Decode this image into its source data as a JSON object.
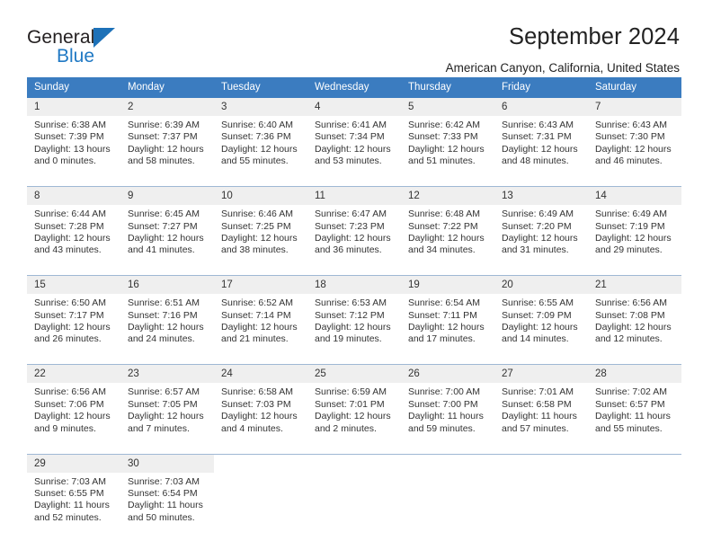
{
  "brand": {
    "name_top": "General",
    "name_bottom": "Blue",
    "triangle_color": "#1d71b8",
    "text_color": "#231f20",
    "blue_text_color": "#2079c4"
  },
  "header": {
    "title": "September 2024",
    "subtitle": "American Canyon, California, United States"
  },
  "theme": {
    "header_bg": "#3b7cc0",
    "header_text": "#ffffff",
    "daynum_bg": "#efefef",
    "border": "#9fb8d4",
    "body_text": "#333333"
  },
  "weekdays": [
    "Sunday",
    "Monday",
    "Tuesday",
    "Wednesday",
    "Thursday",
    "Friday",
    "Saturday"
  ],
  "labels": {
    "sunrise_prefix": "Sunrise:",
    "sunset_prefix": "Sunset:",
    "daylight_prefix": "Daylight:"
  },
  "weeks": [
    [
      {
        "day": "1",
        "sunrise": "Sunrise: 6:38 AM",
        "sunset": "Sunset: 7:39 PM",
        "daylight1": "Daylight: 13 hours",
        "daylight2": "and 0 minutes."
      },
      {
        "day": "2",
        "sunrise": "Sunrise: 6:39 AM",
        "sunset": "Sunset: 7:37 PM",
        "daylight1": "Daylight: 12 hours",
        "daylight2": "and 58 minutes."
      },
      {
        "day": "3",
        "sunrise": "Sunrise: 6:40 AM",
        "sunset": "Sunset: 7:36 PM",
        "daylight1": "Daylight: 12 hours",
        "daylight2": "and 55 minutes."
      },
      {
        "day": "4",
        "sunrise": "Sunrise: 6:41 AM",
        "sunset": "Sunset: 7:34 PM",
        "daylight1": "Daylight: 12 hours",
        "daylight2": "and 53 minutes."
      },
      {
        "day": "5",
        "sunrise": "Sunrise: 6:42 AM",
        "sunset": "Sunset: 7:33 PM",
        "daylight1": "Daylight: 12 hours",
        "daylight2": "and 51 minutes."
      },
      {
        "day": "6",
        "sunrise": "Sunrise: 6:43 AM",
        "sunset": "Sunset: 7:31 PM",
        "daylight1": "Daylight: 12 hours",
        "daylight2": "and 48 minutes."
      },
      {
        "day": "7",
        "sunrise": "Sunrise: 6:43 AM",
        "sunset": "Sunset: 7:30 PM",
        "daylight1": "Daylight: 12 hours",
        "daylight2": "and 46 minutes."
      }
    ],
    [
      {
        "day": "8",
        "sunrise": "Sunrise: 6:44 AM",
        "sunset": "Sunset: 7:28 PM",
        "daylight1": "Daylight: 12 hours",
        "daylight2": "and 43 minutes."
      },
      {
        "day": "9",
        "sunrise": "Sunrise: 6:45 AM",
        "sunset": "Sunset: 7:27 PM",
        "daylight1": "Daylight: 12 hours",
        "daylight2": "and 41 minutes."
      },
      {
        "day": "10",
        "sunrise": "Sunrise: 6:46 AM",
        "sunset": "Sunset: 7:25 PM",
        "daylight1": "Daylight: 12 hours",
        "daylight2": "and 38 minutes."
      },
      {
        "day": "11",
        "sunrise": "Sunrise: 6:47 AM",
        "sunset": "Sunset: 7:23 PM",
        "daylight1": "Daylight: 12 hours",
        "daylight2": "and 36 minutes."
      },
      {
        "day": "12",
        "sunrise": "Sunrise: 6:48 AM",
        "sunset": "Sunset: 7:22 PM",
        "daylight1": "Daylight: 12 hours",
        "daylight2": "and 34 minutes."
      },
      {
        "day": "13",
        "sunrise": "Sunrise: 6:49 AM",
        "sunset": "Sunset: 7:20 PM",
        "daylight1": "Daylight: 12 hours",
        "daylight2": "and 31 minutes."
      },
      {
        "day": "14",
        "sunrise": "Sunrise: 6:49 AM",
        "sunset": "Sunset: 7:19 PM",
        "daylight1": "Daylight: 12 hours",
        "daylight2": "and 29 minutes."
      }
    ],
    [
      {
        "day": "15",
        "sunrise": "Sunrise: 6:50 AM",
        "sunset": "Sunset: 7:17 PM",
        "daylight1": "Daylight: 12 hours",
        "daylight2": "and 26 minutes."
      },
      {
        "day": "16",
        "sunrise": "Sunrise: 6:51 AM",
        "sunset": "Sunset: 7:16 PM",
        "daylight1": "Daylight: 12 hours",
        "daylight2": "and 24 minutes."
      },
      {
        "day": "17",
        "sunrise": "Sunrise: 6:52 AM",
        "sunset": "Sunset: 7:14 PM",
        "daylight1": "Daylight: 12 hours",
        "daylight2": "and 21 minutes."
      },
      {
        "day": "18",
        "sunrise": "Sunrise: 6:53 AM",
        "sunset": "Sunset: 7:12 PM",
        "daylight1": "Daylight: 12 hours",
        "daylight2": "and 19 minutes."
      },
      {
        "day": "19",
        "sunrise": "Sunrise: 6:54 AM",
        "sunset": "Sunset: 7:11 PM",
        "daylight1": "Daylight: 12 hours",
        "daylight2": "and 17 minutes."
      },
      {
        "day": "20",
        "sunrise": "Sunrise: 6:55 AM",
        "sunset": "Sunset: 7:09 PM",
        "daylight1": "Daylight: 12 hours",
        "daylight2": "and 14 minutes."
      },
      {
        "day": "21",
        "sunrise": "Sunrise: 6:56 AM",
        "sunset": "Sunset: 7:08 PM",
        "daylight1": "Daylight: 12 hours",
        "daylight2": "and 12 minutes."
      }
    ],
    [
      {
        "day": "22",
        "sunrise": "Sunrise: 6:56 AM",
        "sunset": "Sunset: 7:06 PM",
        "daylight1": "Daylight: 12 hours",
        "daylight2": "and 9 minutes."
      },
      {
        "day": "23",
        "sunrise": "Sunrise: 6:57 AM",
        "sunset": "Sunset: 7:05 PM",
        "daylight1": "Daylight: 12 hours",
        "daylight2": "and 7 minutes."
      },
      {
        "day": "24",
        "sunrise": "Sunrise: 6:58 AM",
        "sunset": "Sunset: 7:03 PM",
        "daylight1": "Daylight: 12 hours",
        "daylight2": "and 4 minutes."
      },
      {
        "day": "25",
        "sunrise": "Sunrise: 6:59 AM",
        "sunset": "Sunset: 7:01 PM",
        "daylight1": "Daylight: 12 hours",
        "daylight2": "and 2 minutes."
      },
      {
        "day": "26",
        "sunrise": "Sunrise: 7:00 AM",
        "sunset": "Sunset: 7:00 PM",
        "daylight1": "Daylight: 11 hours",
        "daylight2": "and 59 minutes."
      },
      {
        "day": "27",
        "sunrise": "Sunrise: 7:01 AM",
        "sunset": "Sunset: 6:58 PM",
        "daylight1": "Daylight: 11 hours",
        "daylight2": "and 57 minutes."
      },
      {
        "day": "28",
        "sunrise": "Sunrise: 7:02 AM",
        "sunset": "Sunset: 6:57 PM",
        "daylight1": "Daylight: 11 hours",
        "daylight2": "and 55 minutes."
      }
    ],
    [
      {
        "day": "29",
        "sunrise": "Sunrise: 7:03 AM",
        "sunset": "Sunset: 6:55 PM",
        "daylight1": "Daylight: 11 hours",
        "daylight2": "and 52 minutes."
      },
      {
        "day": "30",
        "sunrise": "Sunrise: 7:03 AM",
        "sunset": "Sunset: 6:54 PM",
        "daylight1": "Daylight: 11 hours",
        "daylight2": "and 50 minutes."
      },
      {
        "day": "",
        "sunrise": "",
        "sunset": "",
        "daylight1": "",
        "daylight2": ""
      },
      {
        "day": "",
        "sunrise": "",
        "sunset": "",
        "daylight1": "",
        "daylight2": ""
      },
      {
        "day": "",
        "sunrise": "",
        "sunset": "",
        "daylight1": "",
        "daylight2": ""
      },
      {
        "day": "",
        "sunrise": "",
        "sunset": "",
        "daylight1": "",
        "daylight2": ""
      },
      {
        "day": "",
        "sunrise": "",
        "sunset": "",
        "daylight1": "",
        "daylight2": ""
      }
    ]
  ]
}
